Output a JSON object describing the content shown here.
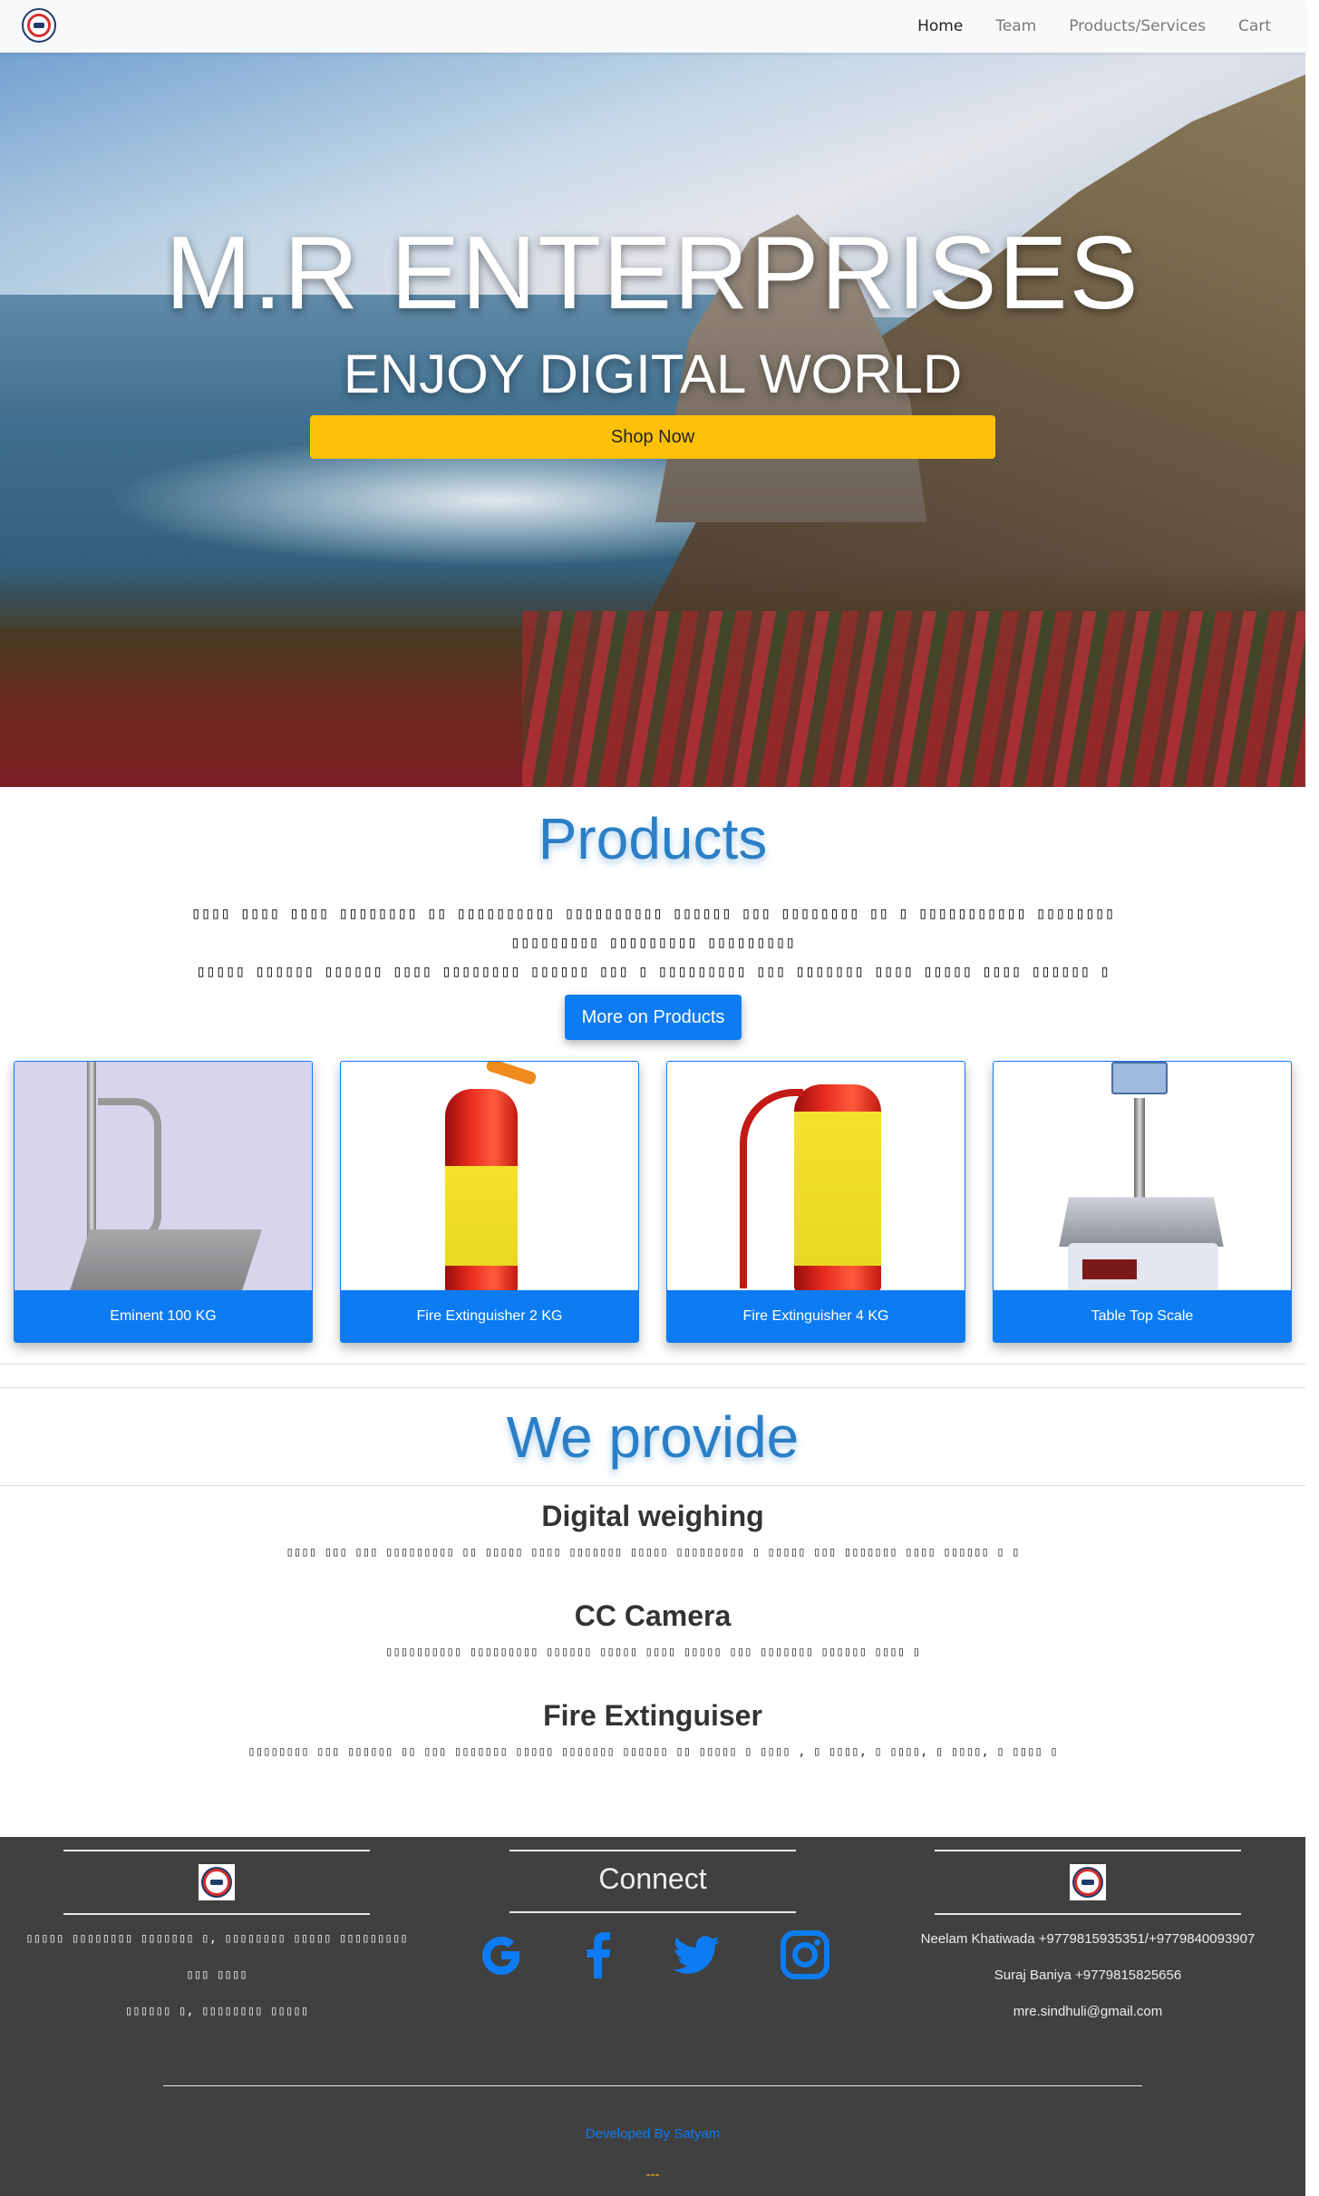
{
  "nav": {
    "links": [
      {
        "label": "Home",
        "active": true
      },
      {
        "label": "Team",
        "active": false
      },
      {
        "label": "Products/Services",
        "active": false
      },
      {
        "label": "Cart",
        "active": false
      }
    ]
  },
  "hero": {
    "title": "M.R ENTERPRISES",
    "subtitle": "ENJOY DIGITAL WORLD",
    "cta": "Shop Now"
  },
  "products": {
    "heading": "Products",
    "description_line1": "▯▯▯▯ ▯▯▯▯ ▯▯▯▯ ▯▯▯▯▯▯▯▯ ▯▯ ▯▯▯▯▯▯▯▯▯▯ ▯▯▯▯▯▯▯▯▯▯ ▯▯▯▯▯▯ ▯▯▯ ▯▯▯▯▯▯▯▯ ▯▯ ▯ ▯▯▯▯▯▯▯▯▯▯▯ ▯▯▯▯▯▯▯▯ ▯▯▯▯▯▯▯▯▯ ▯▯▯▯▯▯▯▯▯ ▯▯▯▯▯▯▯▯▯",
    "description_line2": "▯▯▯▯▯ ▯▯▯▯▯▯ ▯▯▯▯▯▯ ▯▯▯▯ ▯▯▯▯▯▯▯▯ ▯▯▯▯▯▯ ▯▯▯ ▯ ▯▯▯▯▯▯▯▯▯ ▯▯▯ ▯▯▯▯▯▯▯ ▯▯▯▯ ▯▯▯▯▯ ▯▯▯▯ ▯▯▯▯▯▯ ▯",
    "more_button": "More on Products",
    "cards": [
      {
        "label": "Eminent 100 KG"
      },
      {
        "label": "Fire Extinguisher 2 KG"
      },
      {
        "label": "Fire Extinguisher 4 KG"
      },
      {
        "label": "Table Top Scale"
      }
    ]
  },
  "provide": {
    "heading": "We provide",
    "services": [
      {
        "title": "Digital weighing",
        "desc": "▯▯▯▯ ▯▯▯ ▯▯▯ ▯▯▯▯▯▯▯▯▯ ▯▯ ▯▯▯▯▯ ▯▯▯▯ ▯▯▯▯▯▯▯ ▯▯▯▯▯ ▯▯▯▯▯▯▯▯▯ ▯ ▯▯▯▯▯ ▯▯▯ ▯▯▯▯▯▯▯ ▯▯▯▯ ▯▯▯▯▯▯ ▯ ▯"
      },
      {
        "title": "CC Camera",
        "desc": "▯▯▯▯▯▯▯▯▯▯ ▯▯▯▯▯▯▯▯▯ ▯▯▯▯▯▯ ▯▯▯▯▯ ▯▯▯▯ ▯▯▯▯▯ ▯▯▯ ▯▯▯▯▯▯▯ ▯▯▯▯▯▯ ▯▯▯▯ ▯"
      },
      {
        "title": "Fire Extinguiser",
        "desc": "▯▯▯▯▯▯▯▯ ▯▯▯ ▯▯▯▯▯▯ ▯▯ ▯▯▯ ▯▯▯▯▯▯▯ ▯▯▯▯▯ ▯▯▯▯▯▯▯ ▯▯▯▯▯▯ ▯▯ ▯▯▯▯▯ ▯ ▯▯▯▯ , ▯ ▯▯▯▯, ▯ ▯▯▯▯, ▯ ▯▯▯▯, ▯ ▯▯▯▯ ▯"
      }
    ]
  },
  "footer": {
    "address_line1": "▯▯▯▯▯ ▯▯▯▯▯▯▯▯ ▯▯▯▯▯▯▯ ▯, ▯▯▯▯▯▯▯▯ ▯▯▯▯▯ ▯▯▯▯▯▯▯▯▯ ▯▯▯ ▯▯▯▯",
    "address_line2": "▯▯▯▯▯▯ ▯, ▯▯▯▯▯▯▯▯ ▯▯▯▯▯",
    "connect_heading": "Connect",
    "social_icons": [
      "google-icon",
      "facebook-icon",
      "twitter-icon",
      "instagram-icon"
    ],
    "contacts": [
      "Neelam Khatiwada +9779815935351/+9779840093907",
      "Suraj Baniya +9779815825656",
      "mre.sindhuli@gmail.com"
    ],
    "developed_by": "Developed By Satyam",
    "dashes": "---"
  },
  "colors": {
    "accent": "#0d7cf2",
    "heading_blue": "#2a7fc6",
    "cta_yellow": "#ffc107",
    "footer_bg": "#404040"
  }
}
